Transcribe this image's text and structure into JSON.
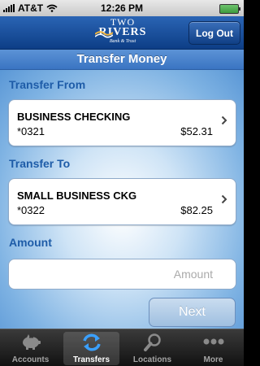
{
  "status_bar": {
    "carrier": "AT&T",
    "time": "12:26 PM"
  },
  "header": {
    "logo": {
      "line1": "TWO",
      "line2": "RIVERS",
      "line3": "Bank & Trust"
    },
    "logout_label": "Log Out"
  },
  "title": "Transfer Money",
  "transfer_from": {
    "label": "Transfer From",
    "account_name": "BUSINESS CHECKING",
    "account_number": "*0321",
    "balance": "$52.31"
  },
  "transfer_to": {
    "label": "Transfer To",
    "account_name": "SMALL BUSINESS CKG",
    "account_number": "*0322",
    "balance": "$82.25"
  },
  "amount": {
    "label": "Amount",
    "placeholder": "Amount",
    "value": ""
  },
  "next_label": "Next",
  "tabs": [
    {
      "label": "Accounts",
      "icon": "piggy-bank-icon",
      "active": false
    },
    {
      "label": "Transfers",
      "icon": "transfer-arrows-icon",
      "active": true
    },
    {
      "label": "Locations",
      "icon": "magnifier-icon",
      "active": false
    },
    {
      "label": "More",
      "icon": "more-dots-icon",
      "active": false
    }
  ],
  "colors": {
    "header": "#1a4f9c",
    "section_label": "#1e5ca8",
    "title_bar": "#4a84cc"
  }
}
